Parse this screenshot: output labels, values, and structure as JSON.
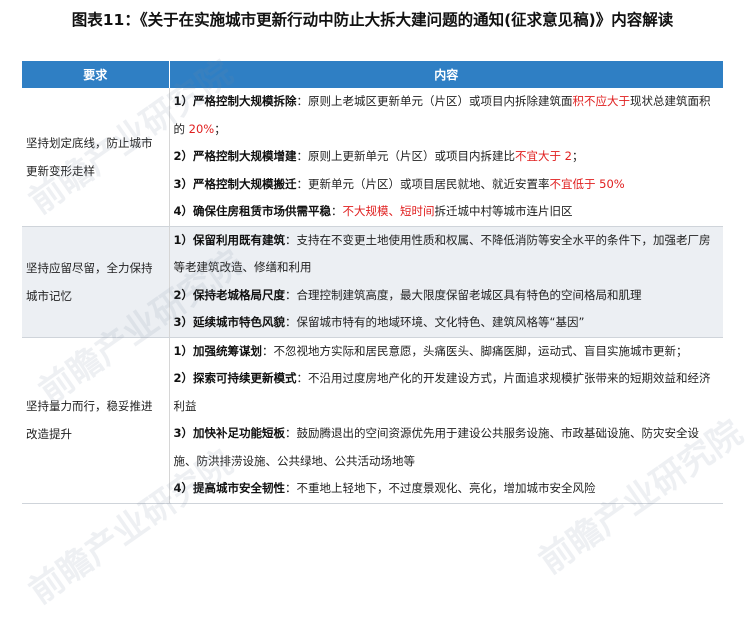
{
  "title": "图表11：《关于在实施城市更新行动中防止大拆大建问题的通知(征求意见稿)》内容解读",
  "watermark": "前瞻产业研究院",
  "table": {
    "headers": [
      "要求",
      "内容"
    ],
    "groups": [
      {
        "requirement": "坚持划定底线，防止城市更新变形走样",
        "items": [
          {
            "num": "1）",
            "bold": "严格控制大规模拆除",
            "sep": "：",
            "t1": "原则上老城区更新单元（片区）或项目内拆除建筑面",
            "r1": "积不应大于",
            "t2": "现状总建筑面积的 ",
            "r2": "20%",
            "t3": "；"
          },
          {
            "num": "2）",
            "bold": "严格控制大规模增建",
            "sep": "：",
            "t1": "原则上更新单元（片区）或项目内拆建比",
            "r1": "不宜大于 2",
            "t2": "；",
            "r2": "",
            "t3": ""
          },
          {
            "num": "3）",
            "bold": "严格控制大规模搬迁",
            "sep": "：",
            "t1": "更新单元（片区）或项目居民就地、就近安置率",
            "r1": "不宜低于 50%",
            "t2": "",
            "r2": "",
            "t3": ""
          },
          {
            "num": "4）",
            "bold": "确保住房租赁市场供需平稳",
            "sep": "：",
            "t1": "",
            "r1": "不大规模、短时间",
            "t2": "拆迁城中村等城市连片旧区",
            "r2": "",
            "t3": ""
          }
        ]
      },
      {
        "requirement": "坚持应留尽留，全力保持城市记忆",
        "items": [
          {
            "num": "1）",
            "bold": "保留利用既有建筑",
            "sep": "：",
            "t1": "支持在不变更土地使用性质和权属、不降低消防等安全水平的条件下，加强老厂房等老建筑改造、修缮和利用",
            "r1": "",
            "t2": "",
            "r2": "",
            "t3": ""
          },
          {
            "num": "2）",
            "bold": "保持老城格局尺度",
            "sep": "：",
            "t1": "合理控制建筑高度，最大限度保留老城区具有特色的空间格局和肌理",
            "r1": "",
            "t2": "",
            "r2": "",
            "t3": ""
          },
          {
            "num": "3）",
            "bold": "延续城市特色风貌",
            "sep": "：",
            "t1": "保留城市特有的地域环境、文化特色、建筑风格等“基因”",
            "r1": "",
            "t2": "",
            "r2": "",
            "t3": ""
          }
        ]
      },
      {
        "requirement": "坚持量力而行，稳妥推进改造提升",
        "items": [
          {
            "num": "1）",
            "bold": "加强统筹谋划",
            "sep": "：",
            "t1": "不忽视地方实际和居民意愿，头痛医头、脚痛医脚，运动式、盲目实施城市更新；",
            "r1": "",
            "t2": "",
            "r2": "",
            "t3": ""
          },
          {
            "num": "2）",
            "bold": "探索可持续更新模式",
            "sep": "：",
            "t1": "不沿用过度房地产化的开发建设方式，片面追求规模扩张带来的短期效益和经济利益",
            "r1": "",
            "t2": "",
            "r2": "",
            "t3": ""
          },
          {
            "num": "3）",
            "bold": "加快补足功能短板",
            "sep": "：",
            "t1": "鼓励腾退出的空间资源优先用于建设公共服务设施、市政基础设施、防灾安全设施、防洪排涝设施、公共绿地、公共活动场地等",
            "r1": "",
            "t2": "",
            "r2": "",
            "t3": ""
          },
          {
            "num": "4）",
            "bold": "提高城市安全韧性",
            "sep": "：",
            "t1": "不重地上轻地下，不过度景观化、亮化，增加城市安全风险",
            "r1": "",
            "t2": "",
            "r2": "",
            "t3": ""
          }
        ]
      }
    ]
  },
  "colors": {
    "header_bg": "#2f7fc4",
    "highlight": "#e02020",
    "row_grey": "#eceff3"
  }
}
